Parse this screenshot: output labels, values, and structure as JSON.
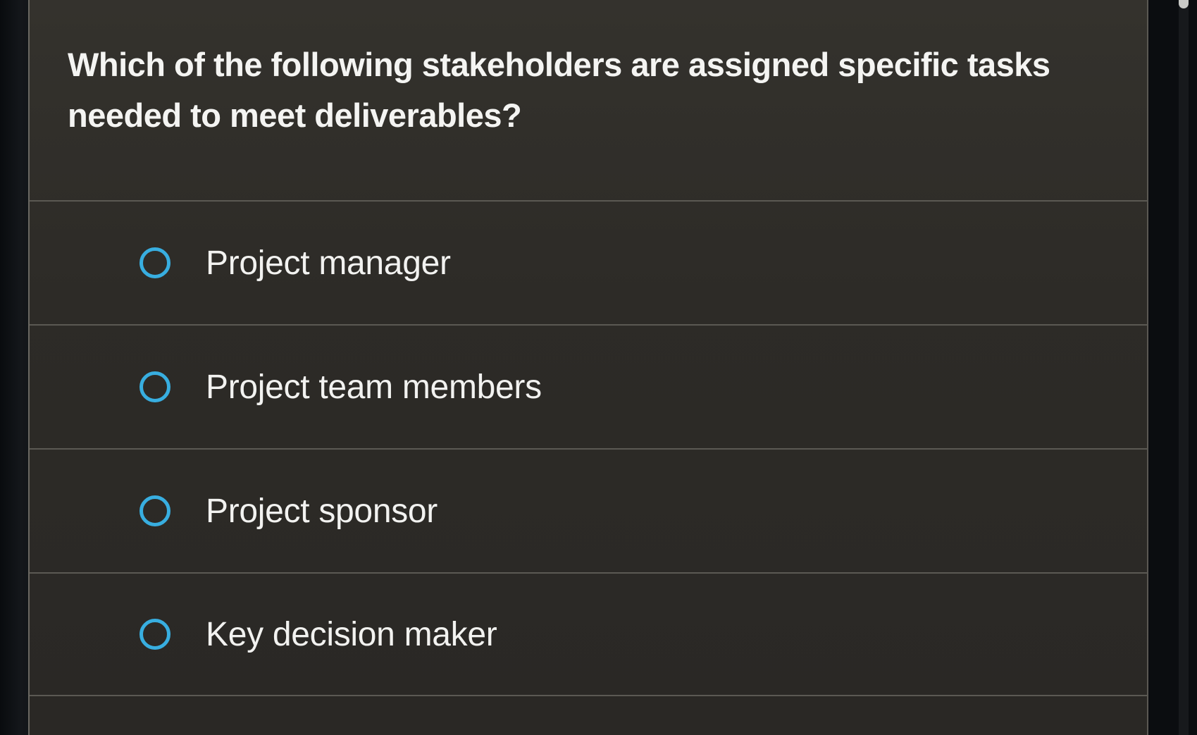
{
  "question": {
    "text": "Which of the following stakeholders are assigned specific tasks needed to meet deliverables?"
  },
  "options": [
    {
      "label": "Project manager",
      "selected": false
    },
    {
      "label": "Project team members",
      "selected": false
    },
    {
      "label": "Project sponsor",
      "selected": false
    },
    {
      "label": "Key decision maker",
      "selected": false
    }
  ],
  "colors": {
    "radio_accent": "#38aee0",
    "panel_background": "#2d2b27",
    "text": "#f4f4f2"
  }
}
